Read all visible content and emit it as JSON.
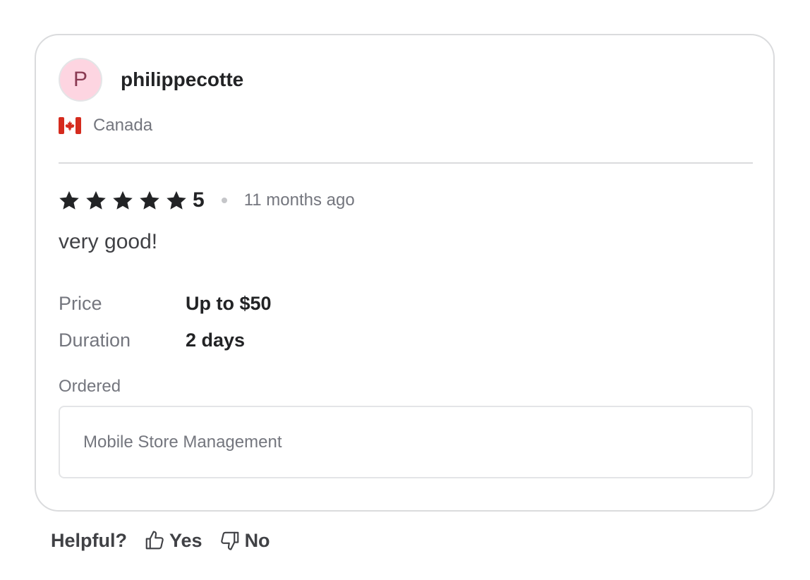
{
  "review": {
    "user": {
      "avatar_initial": "P",
      "username": "philippecotte",
      "country": "Canada",
      "flag_icon": "canada-flag-icon"
    },
    "rating": {
      "stars": 5,
      "value": "5",
      "time_ago": "11 months ago"
    },
    "text": "very good!",
    "details": [
      {
        "label": "Price",
        "value": "Up to $50"
      },
      {
        "label": "Duration",
        "value": "2 days"
      }
    ],
    "ordered": {
      "label": "Ordered",
      "item": "Mobile Store Management"
    }
  },
  "helpful": {
    "label": "Helpful?",
    "yes_label": "Yes",
    "no_label": "No",
    "yes_icon": "thumbs-up-icon",
    "no_icon": "thumbs-down-icon"
  },
  "colors": {
    "avatar_bg": "#fdd5e1",
    "avatar_text": "#8a3a52",
    "text_primary": "#222325",
    "text_muted": "#74767e",
    "border": "#dadbdd"
  }
}
